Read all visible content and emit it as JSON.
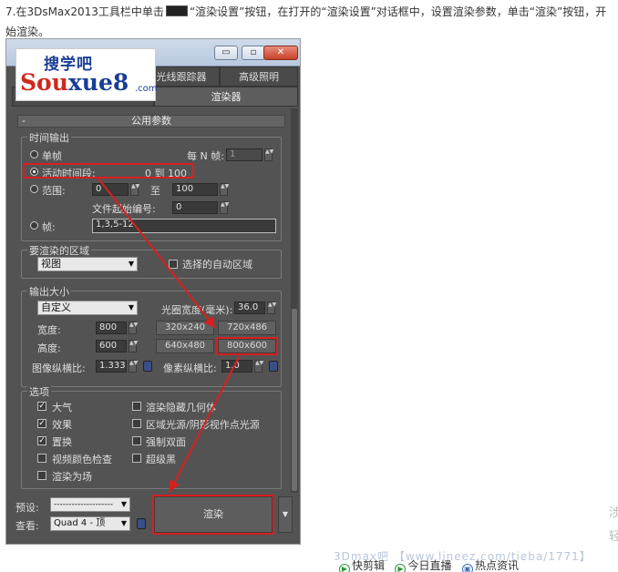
{
  "article": {
    "step_text_before": "7.在3DsMax2013工具栏中单击",
    "step_text_after": "“渲染设置”按钮，在打开的“渲染设置”对话框中，设置渲染参数，单击“渲染”按钮，开始渲染。"
  },
  "logo": {
    "top": "搜学吧",
    "main_a": "Sou",
    "main_b": "xue8",
    "domain": ".com"
  },
  "tabs": {
    "ray_tracer": "光线跟踪器",
    "advanced_lighting": "高级照明",
    "renderer": "渲染器"
  },
  "rollout": {
    "title": "公用参数",
    "collapse": "-"
  },
  "time_output": {
    "label": "时间输出",
    "single": "单帧",
    "every_n": "每 N 帧:",
    "every_n_value": "1",
    "active_segment": "活动时间段:",
    "active_segment_value": "0 到 100",
    "range": "范围:",
    "range_from": "0",
    "range_to_label": "至",
    "range_to": "100",
    "file_number": "文件起始编号:",
    "file_number_value": "0",
    "frames": "帧:",
    "frames_value": "1,3,5-12"
  },
  "area": {
    "label": "要渲染的区域",
    "selected": "视图",
    "auto_region": "选择的自动区域"
  },
  "output_size": {
    "label": "输出大小",
    "preset": "自定义",
    "aperture_label": "光圈宽度(毫米):",
    "aperture_value": "36.0",
    "width_label": "宽度:",
    "width_value": "800",
    "height_label": "高度:",
    "height_value": "600",
    "presets": [
      "320x240",
      "720x486",
      "640x480",
      "800x600"
    ],
    "image_aspect_label": "图像纵横比:",
    "image_aspect_value": "1.333",
    "pixel_aspect_label": "像素纵横比:",
    "pixel_aspect_value": "1.0"
  },
  "options": {
    "label": "选项",
    "atmosphere": "大气",
    "effects": "效果",
    "displacement": "置换",
    "video_color_check": "视频颜色检查",
    "render_to_fields": "渲染为场",
    "render_hidden": "渲染隐藏几何体",
    "area_lights": "区域光源/阴影视作点光源",
    "force_two_sided": "强制双面",
    "super_black": "超级黑"
  },
  "bottom": {
    "preset_label": "预设:",
    "preset_value": "--------------------",
    "view_label": "查看:",
    "view_value": "Quad 4 - 顶",
    "render_button": "渲染"
  },
  "watermark": "3Dmax吧 【www.lineez.com/tieba/1771】",
  "footer": {
    "quick_cut": "快剪辑",
    "live": "今日直播",
    "hot_news": "热点资讯"
  },
  "side_chars": [
    "涉",
    "轻"
  ]
}
